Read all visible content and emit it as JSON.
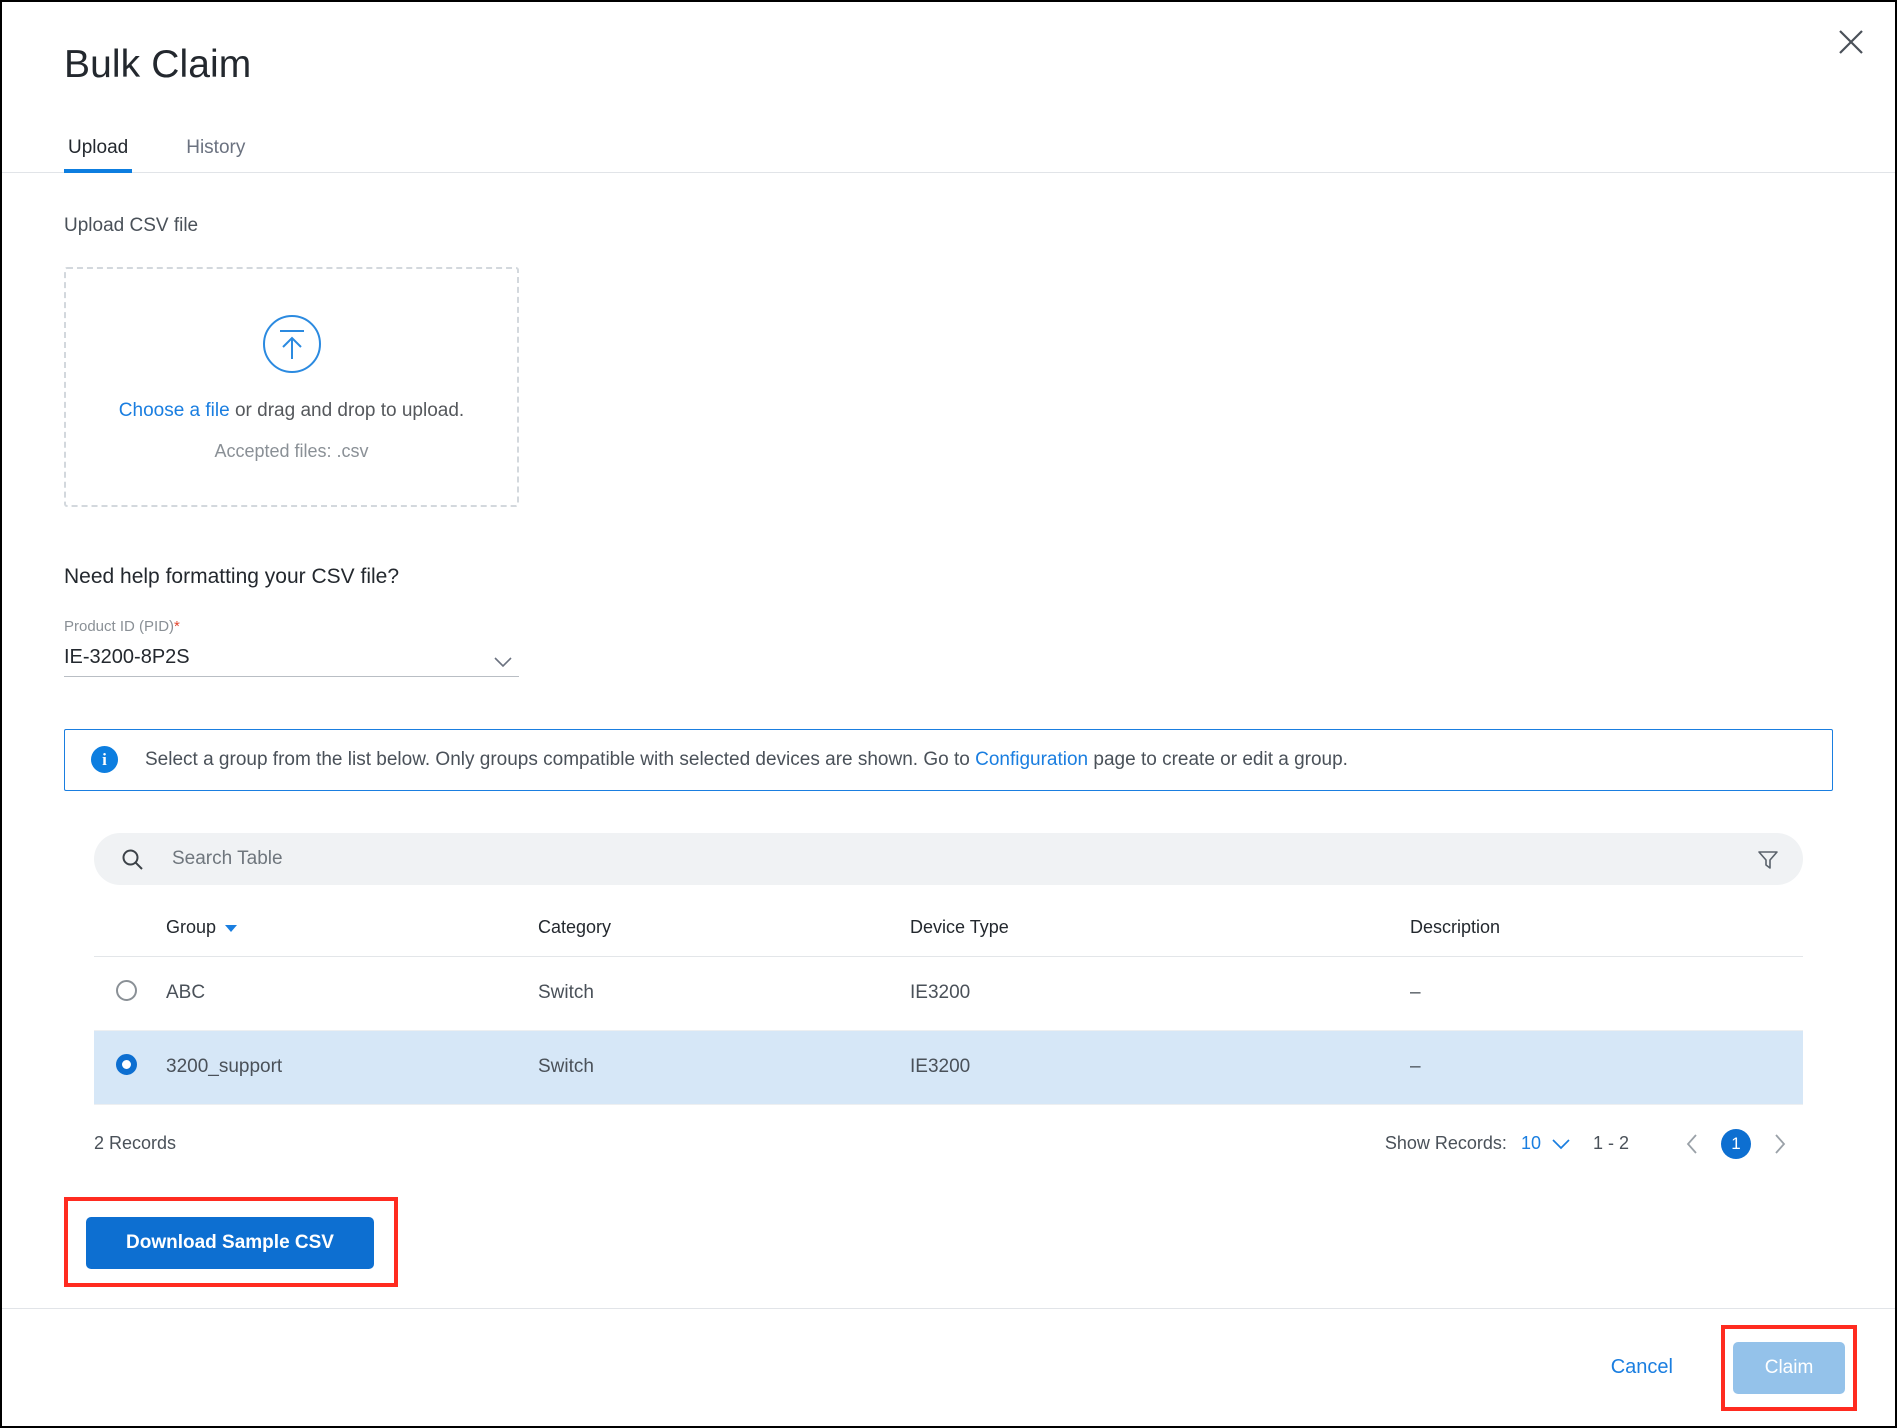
{
  "dialog": {
    "title": "Bulk Claim",
    "close_icon": "close-icon"
  },
  "tabs": [
    {
      "label": "Upload",
      "active": true
    },
    {
      "label": "History",
      "active": false
    }
  ],
  "upload": {
    "section_label": "Upload CSV file",
    "icon": "upload-arrow-icon",
    "choose_link": "Choose a file",
    "drop_text": " or drag and drop to upload.",
    "accepted": "Accepted files: .csv"
  },
  "help": {
    "title": "Need help formatting your CSV file?",
    "pid_label": "Product ID (PID)",
    "pid_required": "*",
    "pid_value": "IE-3200-8P2S",
    "pid_chevron": "chevron-down-icon"
  },
  "info": {
    "icon": "info-icon",
    "text_before": "Select a group from the list below. Only groups compatible with selected devices are shown. Go to ",
    "link": "Configuration",
    "text_after": " page to create or edit a group."
  },
  "search": {
    "icon": "search-icon",
    "placeholder": "Search Table",
    "value": "",
    "filter_icon": "filter-icon"
  },
  "table": {
    "columns": [
      "Group",
      "Category",
      "Device Type",
      "Description"
    ],
    "sort_column": "Group",
    "rows": [
      {
        "selected": false,
        "group": "ABC",
        "category": "Switch",
        "device_type": "IE3200",
        "description": "–"
      },
      {
        "selected": true,
        "group": "3200_support",
        "category": "Switch",
        "device_type": "IE3200",
        "description": "–"
      }
    ]
  },
  "pagination": {
    "records_label": "2 Records",
    "show_records_label": "Show Records:",
    "show_records_value": "10",
    "range": "1 - 2",
    "current_page": "1",
    "prev_icon": "chevron-left-icon",
    "next_icon": "chevron-right-icon"
  },
  "actions": {
    "download_label": "Download Sample CSV",
    "cancel_label": "Cancel",
    "claim_label": "Claim"
  },
  "colors": {
    "accent_blue": "#0d6fd1",
    "link_blue": "#1a7ee0",
    "selected_row": "#d6e7f7",
    "highlight_red": "#ff2b20",
    "claim_disabled": "#94c2ea",
    "required_star": "#e2462f"
  }
}
